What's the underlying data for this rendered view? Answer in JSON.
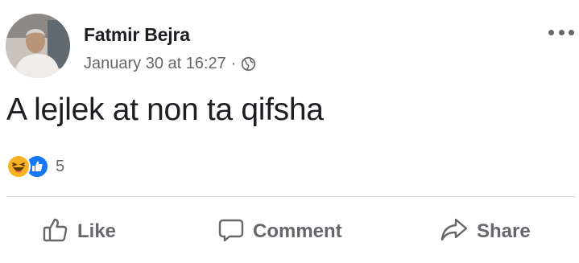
{
  "post": {
    "author": "Fatmir Bejra",
    "timestamp": "January 30 at 16:27",
    "separator": "·",
    "privacy_icon": "globe-icon",
    "text": "A lejlek at non ta qifsha",
    "more_icon": "more-options-icon"
  },
  "reactions": {
    "types": [
      "haha",
      "like"
    ],
    "count": "5"
  },
  "actions": {
    "like_label": "Like",
    "comment_label": "Comment",
    "share_label": "Share"
  },
  "colors": {
    "text_primary": "#1c1e21",
    "text_secondary": "#65676b",
    "like_blue": "#1877f2",
    "haha_yellow": "#f7b125",
    "divider": "#ced0d4"
  }
}
